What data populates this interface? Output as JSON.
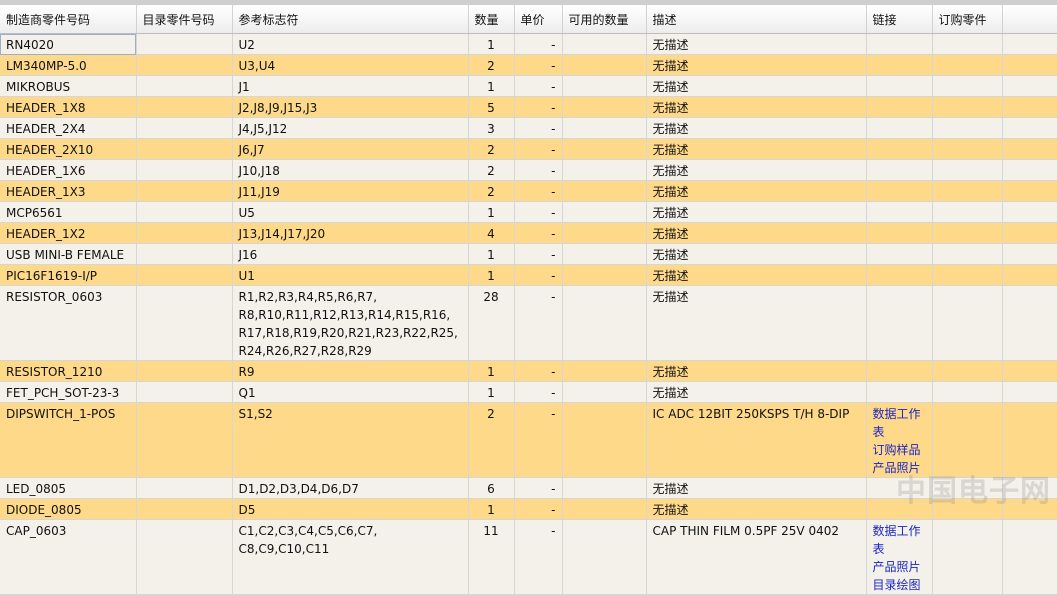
{
  "columns": [
    "制造商零件号码",
    "目录零件号码",
    "参考标志符",
    "数量",
    "单价",
    "可用的数量",
    "描述",
    "链接",
    "订购零件"
  ],
  "rows": [
    {
      "mfg": "RN4020",
      "catalog": "",
      "refs": "U2",
      "qty": "1",
      "price": "-",
      "avail": "",
      "desc": "无描述",
      "links": [],
      "order": ""
    },
    {
      "mfg": "LM340MP-5.0",
      "catalog": "",
      "refs": "U3,U4",
      "qty": "2",
      "price": "-",
      "avail": "",
      "desc": "无描述",
      "links": [],
      "order": ""
    },
    {
      "mfg": "MIKROBUS",
      "catalog": "",
      "refs": "J1",
      "qty": "1",
      "price": "-",
      "avail": "",
      "desc": "无描述",
      "links": [],
      "order": ""
    },
    {
      "mfg": "HEADER_1X8",
      "catalog": "",
      "refs": "J2,J8,J9,J15,J3",
      "qty": "5",
      "price": "-",
      "avail": "",
      "desc": "无描述",
      "links": [],
      "order": ""
    },
    {
      "mfg": "HEADER_2X4",
      "catalog": "",
      "refs": "J4,J5,J12",
      "qty": "3",
      "price": "-",
      "avail": "",
      "desc": "无描述",
      "links": [],
      "order": ""
    },
    {
      "mfg": "HEADER_2X10",
      "catalog": "",
      "refs": "J6,J7",
      "qty": "2",
      "price": "-",
      "avail": "",
      "desc": "无描述",
      "links": [],
      "order": ""
    },
    {
      "mfg": "HEADER_1X6",
      "catalog": "",
      "refs": "J10,J18",
      "qty": "2",
      "price": "-",
      "avail": "",
      "desc": "无描述",
      "links": [],
      "order": ""
    },
    {
      "mfg": "HEADER_1X3",
      "catalog": "",
      "refs": "J11,J19",
      "qty": "2",
      "price": "-",
      "avail": "",
      "desc": "无描述",
      "links": [],
      "order": ""
    },
    {
      "mfg": "MCP6561",
      "catalog": "",
      "refs": "U5",
      "qty": "1",
      "price": "-",
      "avail": "",
      "desc": "无描述",
      "links": [],
      "order": ""
    },
    {
      "mfg": "HEADER_1X2",
      "catalog": "",
      "refs": "J13,J14,J17,J20",
      "qty": "4",
      "price": "-",
      "avail": "",
      "desc": "无描述",
      "links": [],
      "order": ""
    },
    {
      "mfg": "USB MINI-B FEMALE",
      "catalog": "",
      "refs": "J16",
      "qty": "1",
      "price": "-",
      "avail": "",
      "desc": "无描述",
      "links": [],
      "order": ""
    },
    {
      "mfg": "PIC16F1619-I/P",
      "catalog": "",
      "refs": "U1",
      "qty": "1",
      "price": "-",
      "avail": "",
      "desc": "无描述",
      "links": [],
      "order": ""
    },
    {
      "mfg": "RESISTOR_0603",
      "catalog": "",
      "refs": "R1,R2,R3,R4,R5,R6,R7, R8,R10,R11,R12,R13,R14,R15,R16, R17,R18,R19,R20,R21,R23,R22,R25, R24,R26,R27,R28,R29",
      "qty": "28",
      "price": "-",
      "avail": "",
      "desc": "无描述",
      "links": [],
      "order": ""
    },
    {
      "mfg": "RESISTOR_1210",
      "catalog": "",
      "refs": "R9",
      "qty": "1",
      "price": "-",
      "avail": "",
      "desc": "无描述",
      "links": [],
      "order": ""
    },
    {
      "mfg": "FET_PCH_SOT-23-3",
      "catalog": "",
      "refs": "Q1",
      "qty": "1",
      "price": "-",
      "avail": "",
      "desc": "无描述",
      "links": [],
      "order": ""
    },
    {
      "mfg": "DIPSWITCH_1-POS",
      "catalog": "",
      "refs": "S1,S2",
      "qty": "2",
      "price": "-",
      "avail": "",
      "desc": "IC ADC 12BIT 250KSPS T/H 8-DIP",
      "links": [
        "数据工作表",
        "订购样品",
        "产品照片"
      ],
      "order": ""
    },
    {
      "mfg": "LED_0805",
      "catalog": "",
      "refs": "D1,D2,D3,D4,D6,D7",
      "qty": "6",
      "price": "-",
      "avail": "",
      "desc": "无描述",
      "links": [],
      "order": ""
    },
    {
      "mfg": "DIODE_0805",
      "catalog": "",
      "refs": "D5",
      "qty": "1",
      "price": "-",
      "avail": "",
      "desc": "无描述",
      "links": [],
      "order": ""
    },
    {
      "mfg": "CAP_0603",
      "catalog": "",
      "refs": "C1,C2,C3,C4,C5,C6,C7, C8,C9,C10,C11",
      "qty": "11",
      "price": "-",
      "avail": "",
      "desc": "CAP THIN FILM 0.5PF 25V 0402",
      "links": [
        "数据工作表",
        "产品照片",
        "目录绘图"
      ],
      "order": ""
    }
  ],
  "watermark": "中国电子网",
  "colors": {
    "row_odd": "#f3f1ea",
    "row_even": "#ffd98a",
    "link": "#1a25c4"
  }
}
